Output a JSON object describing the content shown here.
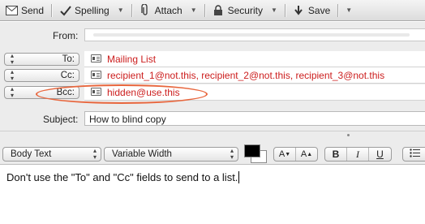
{
  "toolbar": {
    "send_label": "Send",
    "spelling_label": "Spelling",
    "attach_label": "Attach",
    "security_label": "Security",
    "save_label": "Save"
  },
  "header": {
    "from_label": "From:",
    "to_selector": "To:",
    "cc_selector": "Cc:",
    "bcc_selector": "Bcc:",
    "to_value": "Mailing List",
    "cc_value": "recipient_1@not.this, recipient_2@not.this, recipient_3@not.this",
    "bcc_value": "hidden@use.this",
    "subject_label": "Subject:",
    "subject_value": "How to blind copy",
    "highlight_color": "#e8663d",
    "address_color": "#cc1d1d"
  },
  "format_bar": {
    "style_value": "Body Text",
    "spacing_value": "Variable Width",
    "text_color": "#000000",
    "background_color": "#ffffff",
    "shrink_label": "A",
    "grow_label": "A",
    "bold_label": "B",
    "italic_label": "I",
    "underline_label": "U"
  },
  "body": {
    "text": "Don't use the \"To\" and \"Cc\" fields to send to a list."
  }
}
